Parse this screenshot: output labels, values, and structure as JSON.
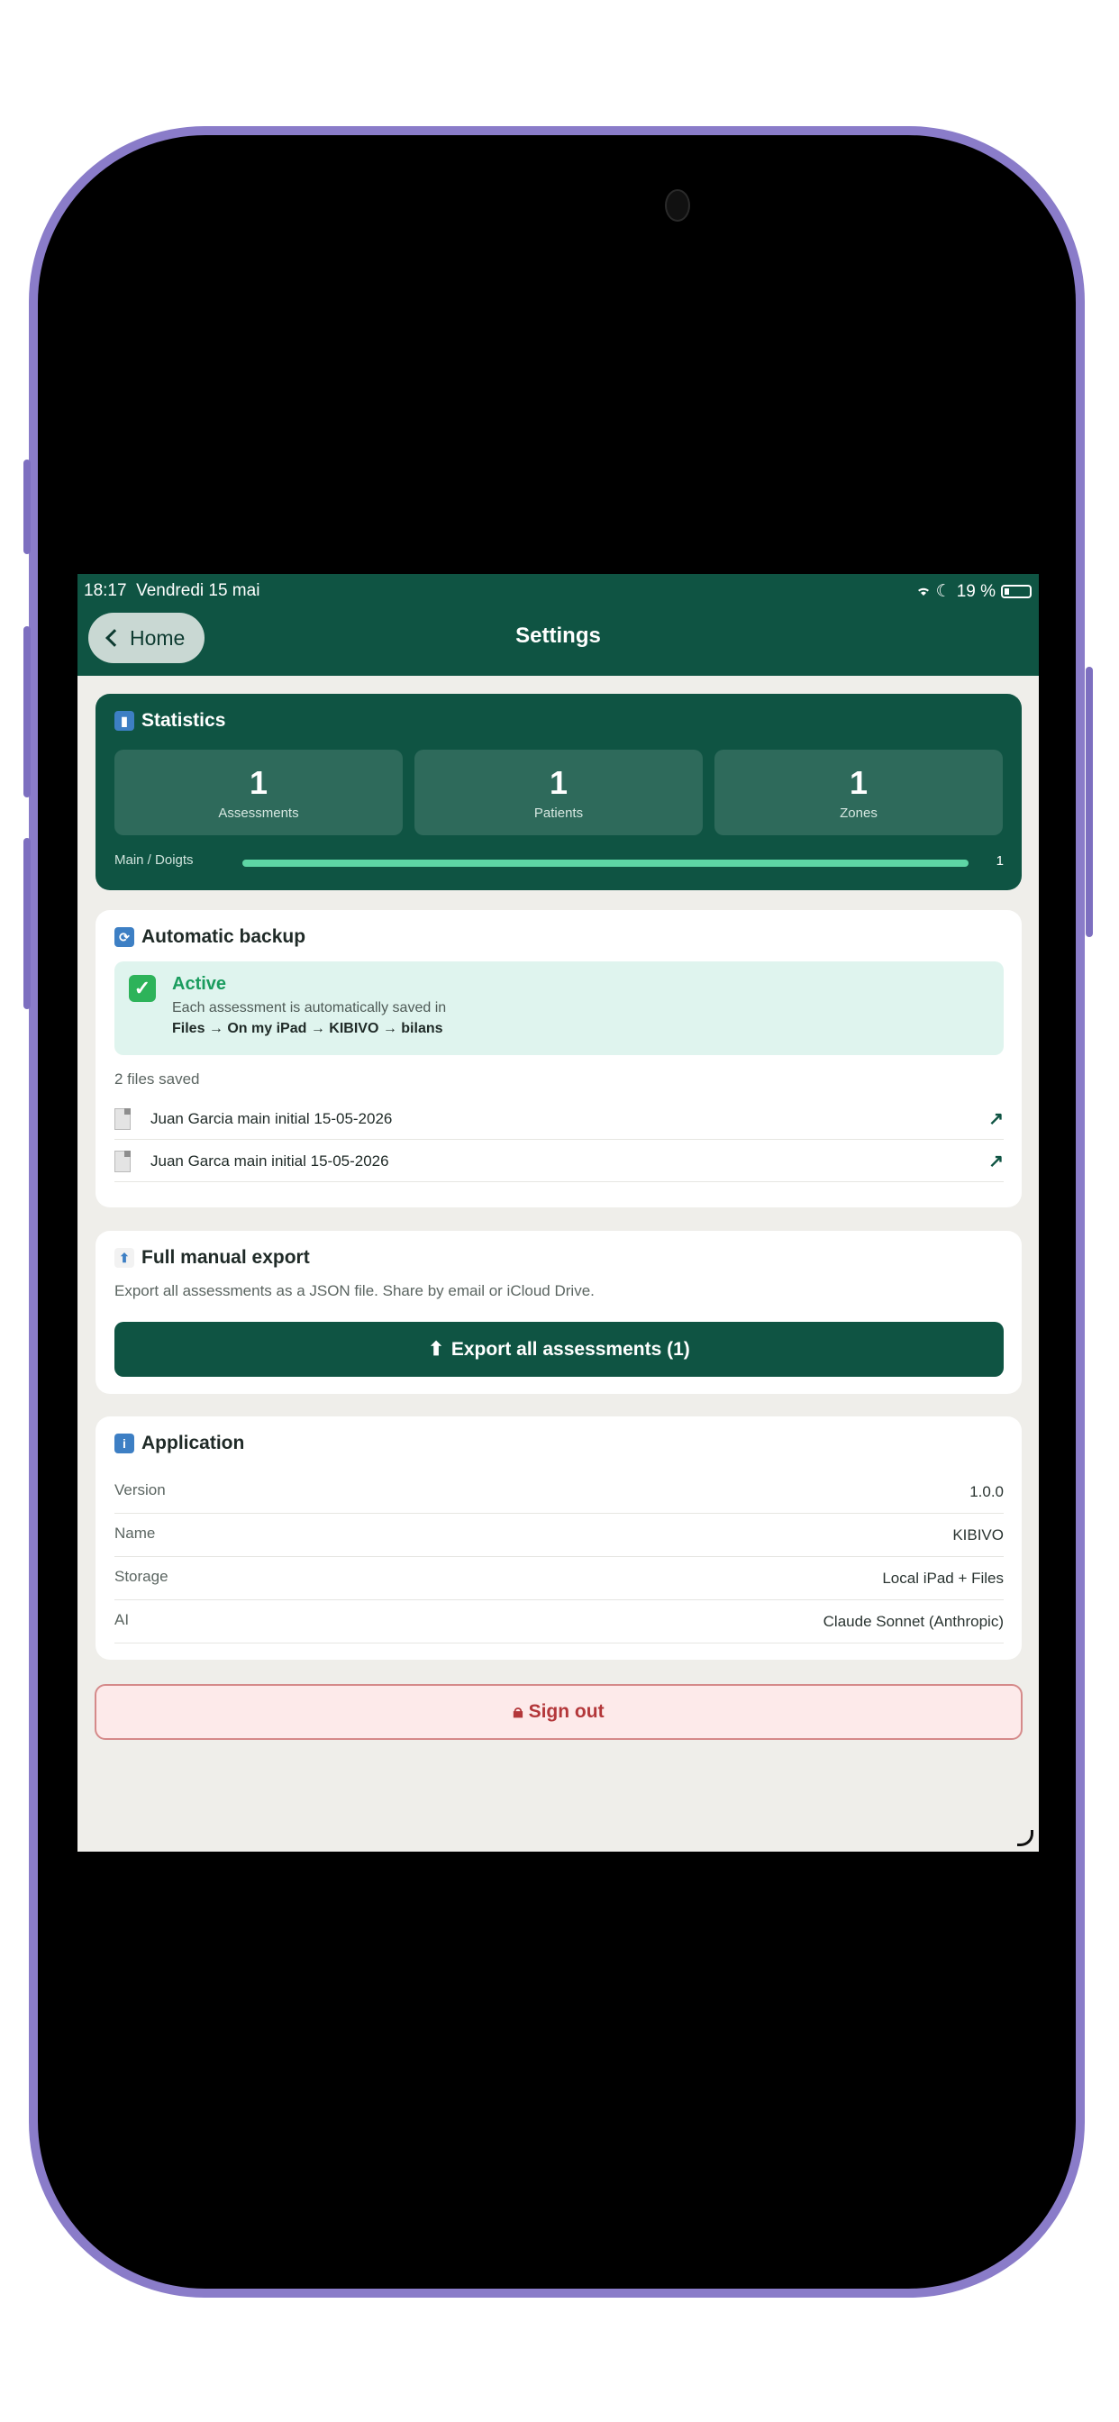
{
  "status": {
    "time": "18:17",
    "date": "Vendredi 15 mai",
    "battery": "19 %"
  },
  "nav": {
    "back_label": "Home",
    "title": "Settings"
  },
  "statistics": {
    "title": "Statistics",
    "items": [
      {
        "value": "1",
        "label": "Assessments"
      },
      {
        "value": "1",
        "label": "Patients"
      },
      {
        "value": "1",
        "label": "Zones"
      }
    ],
    "bar": {
      "label": "Main / Doigts",
      "value": "1",
      "fraction": 1.0
    }
  },
  "backup": {
    "title": "Automatic backup",
    "status": "Active",
    "description": "Each assessment is automatically saved in",
    "path": "Files → On my iPad → KIBIVO → bilans",
    "files_count": "2 files saved",
    "files": [
      {
        "name": "Juan Garcia main initial 15-05-2026"
      },
      {
        "name": "Juan Garca main initial 15-05-2026"
      }
    ]
  },
  "export": {
    "title": "Full manual export",
    "description": "Export all assessments as a JSON file. Share by email or iCloud Drive.",
    "button": "Export all assessments (1)"
  },
  "application": {
    "title": "Application",
    "rows": [
      {
        "key": "Version",
        "value": "1.0.0"
      },
      {
        "key": "Name",
        "value": "KIBIVO"
      },
      {
        "key": "Storage",
        "value": "Local iPad + Files"
      },
      {
        "key": "AI",
        "value": "Claude Sonnet (Anthropic)"
      }
    ]
  },
  "signout": {
    "label": "Sign out"
  },
  "colors": {
    "brand": "#0f5443",
    "accent": "#5ed6a5",
    "danger": "#b3373a"
  },
  "icons": [
    "chart-icon",
    "sync-icon",
    "check-icon",
    "document-icon",
    "open-arrow-icon",
    "upload-icon",
    "info-icon",
    "lock-icon",
    "wifi-icon",
    "moon-icon",
    "battery-icon"
  ]
}
